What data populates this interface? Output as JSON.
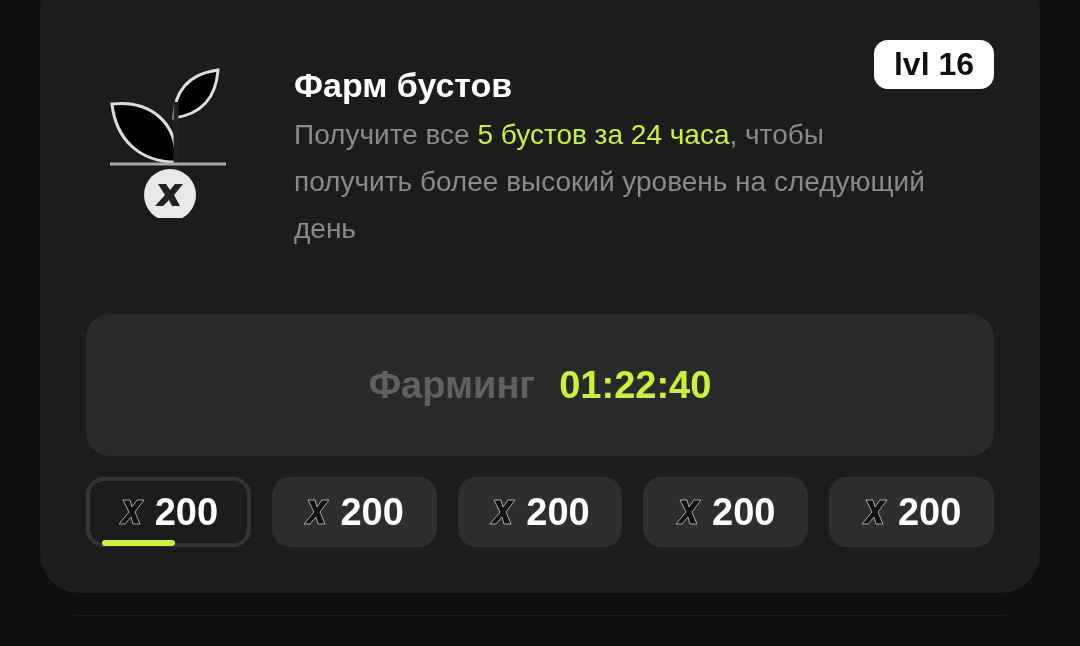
{
  "card": {
    "title": "Фарм бустов",
    "level_badge": "lvl 16",
    "description": [
      {
        "text": "Получите все ",
        "highlight": false
      },
      {
        "text": "5 бустов за 24 часа",
        "highlight": true
      },
      {
        "text": ", чтобы получить более высокий уровень на следующий день",
        "highlight": false
      }
    ],
    "farming": {
      "label": "Фарминг",
      "timer": "01:22:40"
    },
    "boosts": [
      {
        "amount": "200",
        "selected": true
      },
      {
        "amount": "200",
        "selected": false
      },
      {
        "amount": "200",
        "selected": false
      },
      {
        "amount": "200",
        "selected": false
      },
      {
        "amount": "200",
        "selected": false
      }
    ]
  }
}
